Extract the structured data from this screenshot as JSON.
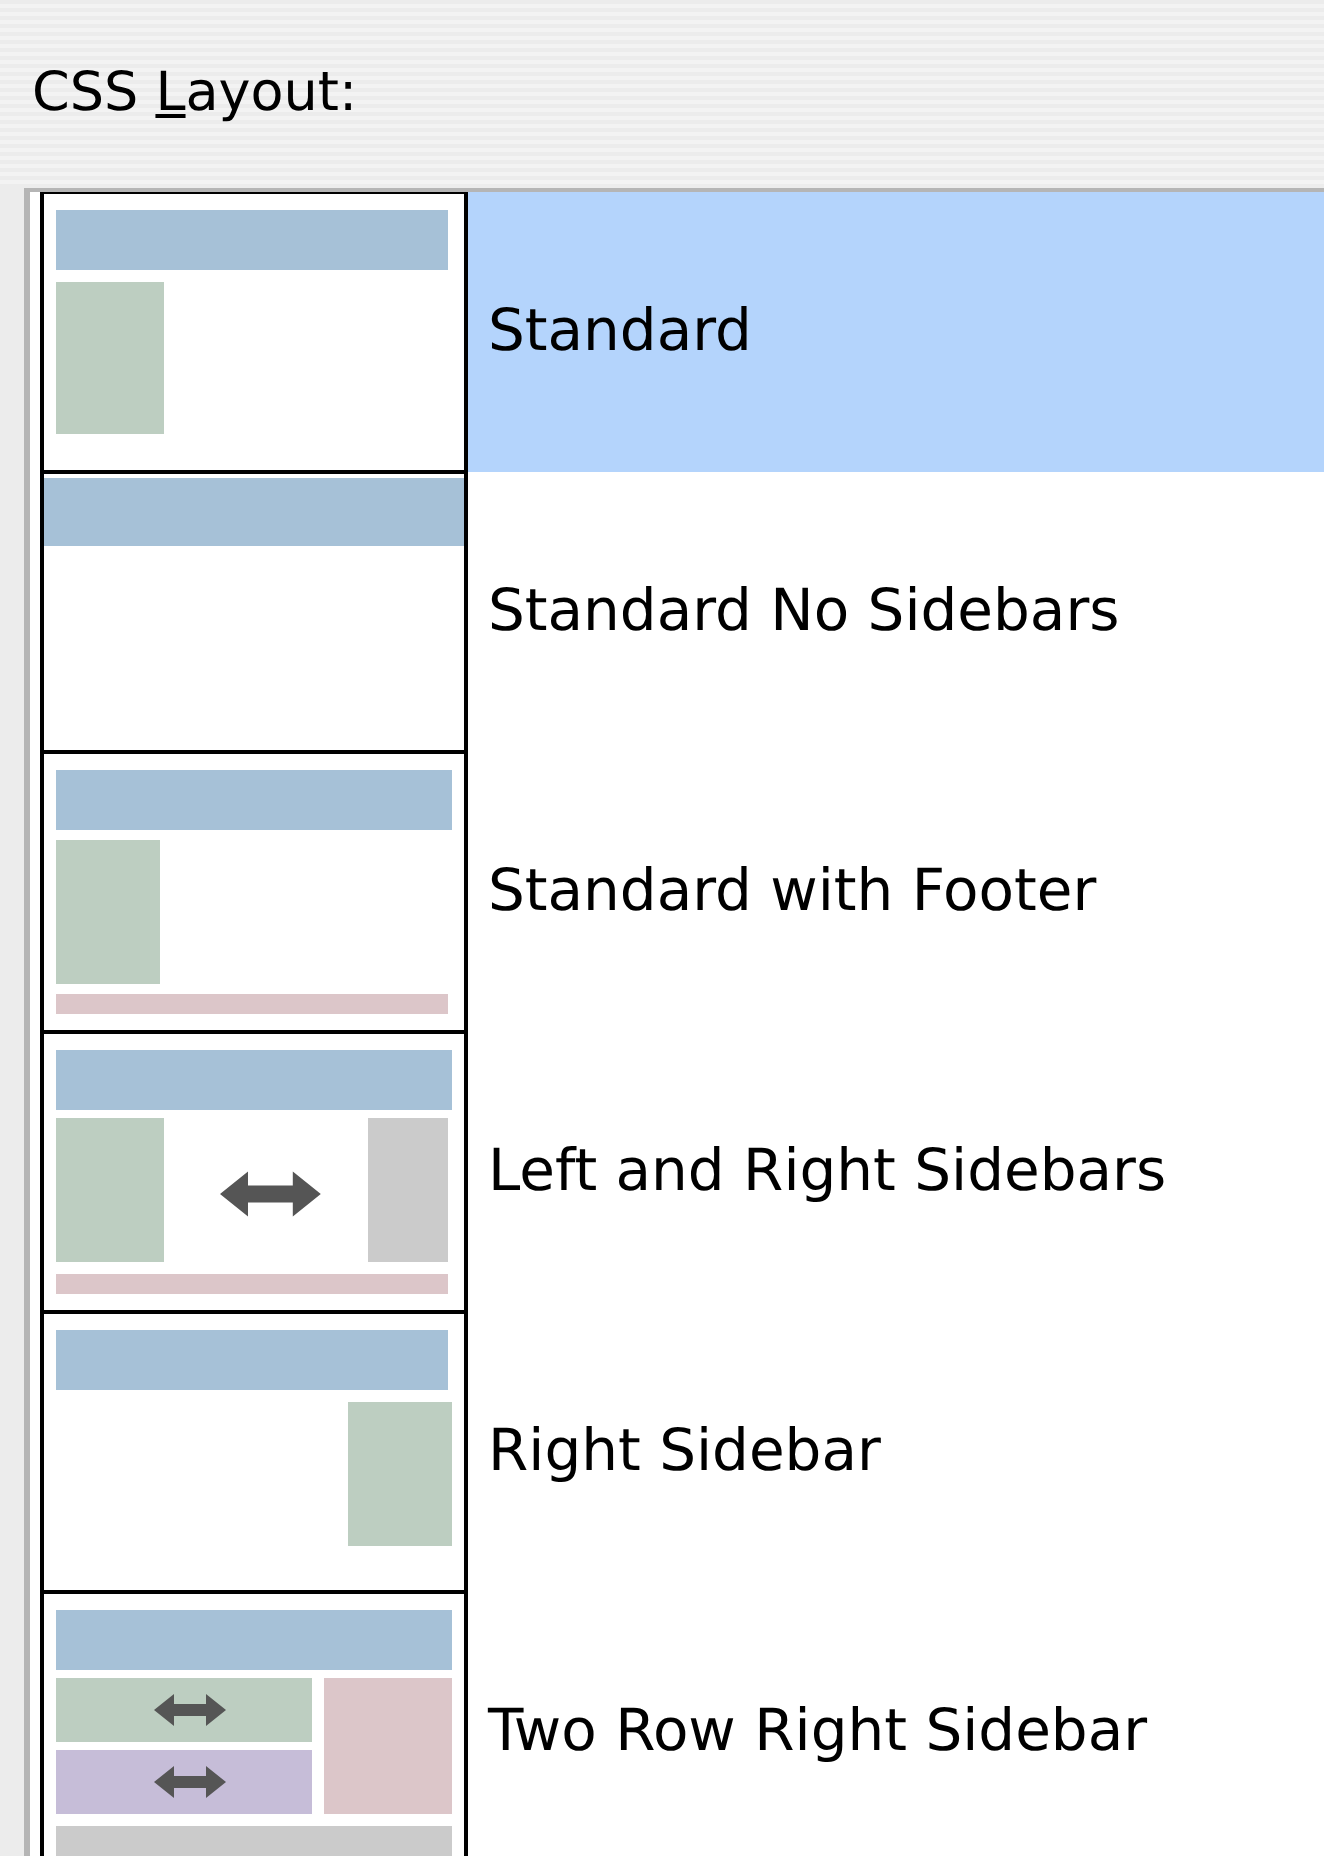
{
  "label": [
    {
      "text": "CSS ",
      "underlined": false
    },
    {
      "text": "L",
      "underlined": true
    },
    {
      "text": "ayout:",
      "underlined": false
    }
  ],
  "layouts": [
    {
      "name": "Standard",
      "kind": "standard",
      "selected": true
    },
    {
      "name": "Standard No Sidebars",
      "kind": "no-sidebars",
      "selected": false
    },
    {
      "name": "Standard with Footer",
      "kind": "footer",
      "selected": false
    },
    {
      "name": "Left and Right Sidebars",
      "kind": "left-right",
      "selected": false
    },
    {
      "name": "Right Sidebar",
      "kind": "right",
      "selected": false
    },
    {
      "name": "Two Row Right Sidebar",
      "kind": "two-row-right",
      "selected": false
    }
  ]
}
